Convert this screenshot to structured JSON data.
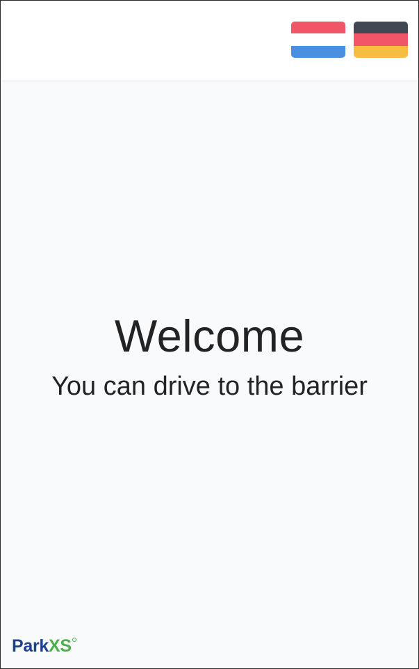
{
  "header": {
    "languages": [
      {
        "code": "nl",
        "icon": "netherlands-flag-icon",
        "stripes": [
          "#f05668",
          "#ffffff",
          "#4a8fe0"
        ]
      },
      {
        "code": "de",
        "icon": "germany-flag-icon",
        "stripes": [
          "#414753",
          "#f05668",
          "#f7bc42"
        ]
      }
    ]
  },
  "main": {
    "title": "Welcome",
    "subtitle": "You can drive to the barrier"
  },
  "footer": {
    "logo_part1": "Park",
    "logo_part2": "XS"
  },
  "colors": {
    "background": "#f9fafc",
    "header": "#ffffff",
    "text": "#232323",
    "logo_blue": "#1f3f8f",
    "logo_green": "#4bb04a"
  }
}
